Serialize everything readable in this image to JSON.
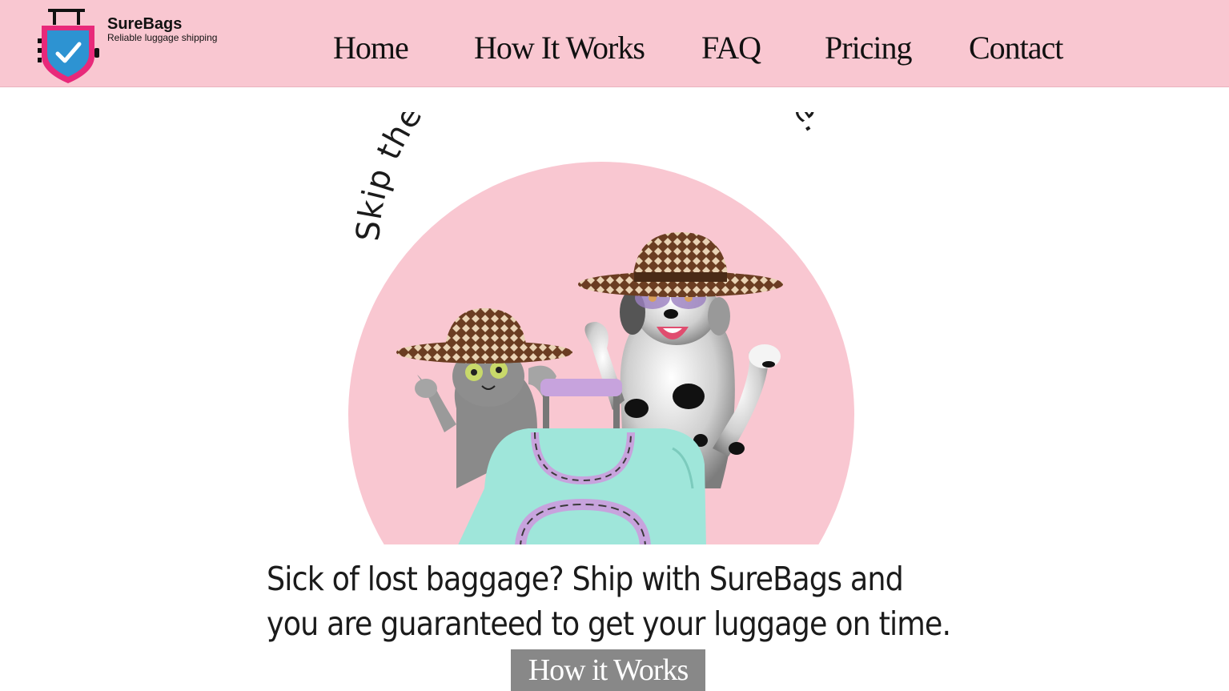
{
  "brand": {
    "name": "SureBags",
    "tagline": "Reliable luggage shipping",
    "logo_icon": "shield-checkmark-luggage-icon"
  },
  "nav": {
    "items": [
      {
        "label": "Home"
      },
      {
        "label": "How It Works"
      },
      {
        "label": "FAQ"
      },
      {
        "label": "Pricing"
      },
      {
        "label": "Contact"
      }
    ]
  },
  "hero": {
    "headline": "Skip the Stress. Ship Your Luggage.",
    "body_line1": "Sick of lost baggage? Ship with SureBags and",
    "body_line2": "you are guaranteed to get your luggage on time.",
    "cta_label": "How it Works",
    "illustration": "cat-and-dog-with-suitcase-illustration"
  },
  "colors": {
    "header_bg": "#f9c7d1",
    "hero_circle": "#f9c7d1",
    "shield_pink": "#e8297a",
    "shield_blue": "#2d93d2",
    "suitcase": "#9fe6da",
    "suitcase_handle": "#c7a3dd",
    "cta_bg": "#888888"
  }
}
